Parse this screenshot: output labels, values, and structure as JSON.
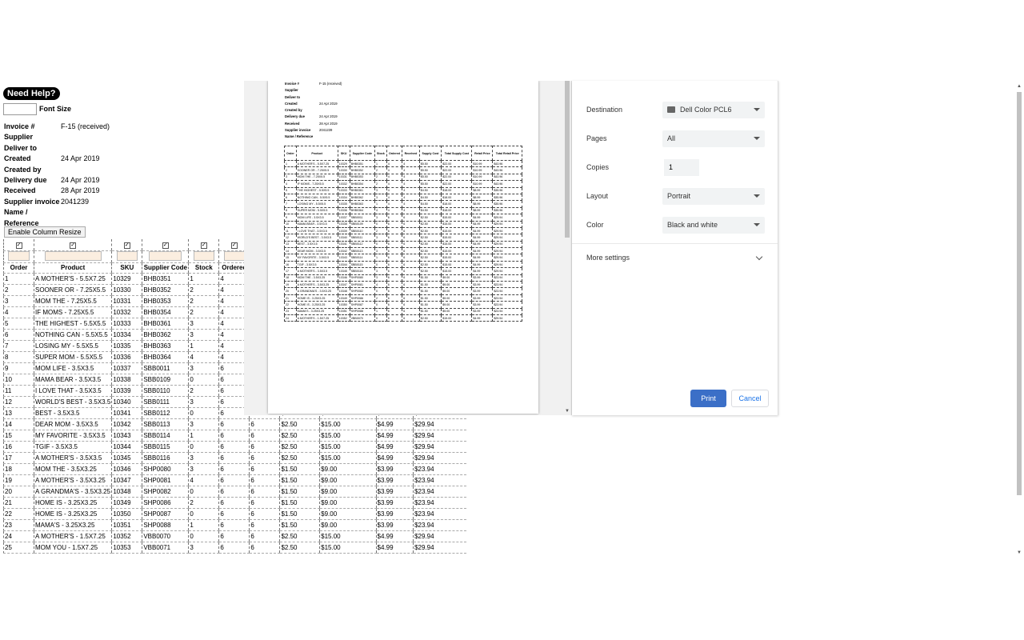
{
  "help_label": "Need Help?",
  "font_size_label": "Font Size",
  "invoice": {
    "rows": [
      {
        "k": "Invoice #",
        "v": "F-15  (received)"
      },
      {
        "k": "Supplier",
        "v": ""
      },
      {
        "k": "Deliver to",
        "v": ""
      },
      {
        "k": "Created",
        "v": "24 Apr 2019"
      },
      {
        "k": "Created by",
        "v": ""
      },
      {
        "k": "Delivery due",
        "v": "24 Apr 2019"
      },
      {
        "k": "Received",
        "v": "28 Apr 2019"
      },
      {
        "k": "Supplier invoice",
        "v": "2041239"
      },
      {
        "k": "Name / Reference",
        "v": ""
      }
    ]
  },
  "enable_resize_label": "Enable Column Resize",
  "table": {
    "headers": [
      "Order",
      "Product",
      "SKU",
      "Supplier Code",
      "Stock",
      "Ordered",
      "Received",
      "Supply Cost",
      "Total Supply Cost",
      "Retail Price",
      "Total Retail Price"
    ],
    "rows": [
      [
        "1",
        "A MOTHER'S - 5.5X7.25",
        "10329",
        "BHB0351",
        "1",
        "4",
        "4",
        "$5.50",
        "$22.00",
        "$10.99",
        "$43.96"
      ],
      [
        "2",
        "SOONER OR - 7.25X5.5",
        "10330",
        "BHB0352",
        "2",
        "4",
        "4",
        "$5.50",
        "$22.00",
        "$10.99",
        "$43.96"
      ],
      [
        "3",
        "MOM THE - 7.25X5.5",
        "10331",
        "BHB0353",
        "2",
        "4",
        "4",
        "$5.50",
        "$22.00",
        "$10.99",
        "$43.96"
      ],
      [
        "4",
        "IF MOMS - 7.25X5.5",
        "10332",
        "BHB0354",
        "2",
        "4",
        "4",
        "$5.50",
        "$22.00",
        "$10.99",
        "$43.96"
      ],
      [
        "5",
        "THE HIGHEST - 5.5X5.5",
        "10333",
        "BHB0361",
        "3",
        "4",
        "4",
        "$4.50",
        "$18.00",
        "$8.99",
        "$35.96"
      ],
      [
        "6",
        "NOTHING CAN - 5.5X5.5",
        "10334",
        "BHB0362",
        "3",
        "4",
        "4",
        "$4.50",
        "$18.00",
        "$8.99",
        "$35.96"
      ],
      [
        "7",
        "LOSING MY - 5.5X5.5",
        "10335",
        "BHB0363",
        "1",
        "4",
        "4",
        "$4.50",
        "$18.00",
        "$8.99",
        "$35.96"
      ],
      [
        "8",
        "SUPER MOM - 5.5X5.5",
        "10336",
        "BHB0364",
        "4",
        "4",
        "4",
        "$4.50",
        "$18.00",
        "$8.99",
        "$35.96"
      ],
      [
        "9",
        "MOM LIFE - 3.5X3.5",
        "10337",
        "SBB0011",
        "3",
        "6",
        "6",
        "$2.50",
        "$15.00",
        "$4.99",
        "$29.94"
      ],
      [
        "10",
        "MAMA BEAR - 3.5X3.5",
        "10338",
        "SBB0109",
        "0",
        "6",
        "6",
        "$2.50",
        "$15.00",
        "$4.99",
        "$29.94"
      ],
      [
        "11",
        "I LOVE THAT - 3.5X3.5",
        "10339",
        "SBB0110",
        "2",
        "6",
        "6",
        "$2.50",
        "$15.00",
        "$4.99",
        "$29.94"
      ],
      [
        "12",
        "WORLD'S BEST - 3.5X3.5",
        "10340",
        "SBB0111",
        "3",
        "6",
        "6",
        "$2.50",
        "$15.00",
        "$4.99",
        "$29.94"
      ],
      [
        "13",
        "BEST - 3.5X3.5",
        "10341",
        "SBB0112",
        "0",
        "6",
        "6",
        "$2.50",
        "$15.00",
        "$4.99",
        "$29.94"
      ],
      [
        "14",
        "DEAR MOM - 3.5X3.5",
        "10342",
        "SBB0113",
        "3",
        "6",
        "6",
        "$2.50",
        "$15.00",
        "$4.99",
        "$29.94"
      ],
      [
        "15",
        "MY FAVORITE - 3.5X3.5",
        "10343",
        "SBB0114",
        "1",
        "6",
        "6",
        "$2.50",
        "$15.00",
        "$4.99",
        "$29.94"
      ],
      [
        "16",
        "TGIF - 3.5X3.5",
        "10344",
        "SBB0115",
        "0",
        "6",
        "6",
        "$2.50",
        "$15.00",
        "$4.99",
        "$29.94"
      ],
      [
        "17",
        "A MOTHER'S - 3.5X3.5",
        "10345",
        "SBB0116",
        "3",
        "6",
        "6",
        "$2.50",
        "$15.00",
        "$4.99",
        "$29.94"
      ],
      [
        "18",
        "MOM THE - 3.5X3.25",
        "10346",
        "SHP0080",
        "3",
        "6",
        "6",
        "$1.50",
        "$9.00",
        "$3.99",
        "$23.94"
      ],
      [
        "19",
        "A MOTHER'S - 3.5X3.25",
        "10347",
        "SHP0081",
        "4",
        "6",
        "6",
        "$1.50",
        "$9.00",
        "$3.99",
        "$23.94"
      ],
      [
        "20",
        "A GRANDMA'S - 3.5X3.25",
        "10348",
        "SHP0082",
        "0",
        "6",
        "6",
        "$1.50",
        "$9.00",
        "$3.99",
        "$23.94"
      ],
      [
        "21",
        "HOME IS - 3.25X3.25",
        "10349",
        "SHP0086",
        "2",
        "6",
        "6",
        "$1.50",
        "$9.00",
        "$3.99",
        "$23.94"
      ],
      [
        "22",
        "HOME IS - 3.25X3.25",
        "10350",
        "SHP0087",
        "0",
        "6",
        "6",
        "$1.50",
        "$9.00",
        "$3.99",
        "$23.94"
      ],
      [
        "23",
        "MAMA'S - 3.25X3.25",
        "10351",
        "SHP0088",
        "1",
        "6",
        "6",
        "$1.50",
        "$9.00",
        "$3.99",
        "$23.94"
      ],
      [
        "24",
        "A MOTHER'S - 1.5X7.25",
        "10352",
        "VBB0070",
        "0",
        "6",
        "6",
        "$2.50",
        "$15.00",
        "$4.99",
        "$29.94"
      ],
      [
        "25",
        "MOM YOU - 1.5X7.25",
        "10353",
        "VBB0071",
        "3",
        "6",
        "6",
        "$2.50",
        "$15.00",
        "$4.99",
        "$29.94"
      ]
    ]
  },
  "print_dialog": {
    "destination_label": "Destination",
    "destination_value": "Dell Color PCL6",
    "pages_label": "Pages",
    "pages_value": "All",
    "copies_label": "Copies",
    "copies_value": "1",
    "layout_label": "Layout",
    "layout_value": "Portrait",
    "color_label": "Color",
    "color_value": "Black and white",
    "more_settings_label": "More settings",
    "print_label": "Print",
    "cancel_label": "Cancel"
  }
}
